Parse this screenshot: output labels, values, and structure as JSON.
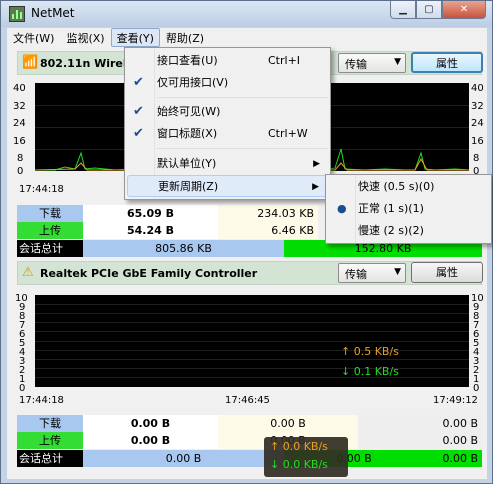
{
  "window": {
    "title": "NetMet"
  },
  "menubar": {
    "items": [
      "文件(W)",
      "监视(X)",
      "查看(Y)",
      "帮助(Z)"
    ]
  },
  "adapters": [
    {
      "name": "802.11n Wireless",
      "icon": "wifi-icon",
      "mode": "传输",
      "properties_label": "属性",
      "y_ticks": [
        "40",
        "32",
        "24",
        "16",
        "8",
        "0"
      ],
      "x_ticks": [
        "17:44:18"
      ],
      "rows": [
        {
          "label": "下载",
          "label_color": "#a8c8f0",
          "v1": "65.09 B",
          "v2": "234.03 KB",
          "v3": ""
        },
        {
          "label": "上传",
          "label_color": "#33dd33",
          "v1": "54.24 B",
          "v2": "6.46 KB",
          "v3": ""
        },
        {
          "label": "会话总计",
          "label_color": "#000000",
          "v1": "805.86 KB",
          "v2": "152.80 KB",
          "v3": ""
        }
      ]
    },
    {
      "name": "Realtek PCIe GbE Family Controller",
      "icon": "warning-icon",
      "mode": "传输",
      "properties_label": "属性",
      "y_ticks": [
        "10",
        "9",
        "8",
        "7",
        "6",
        "5",
        "4",
        "3",
        "2",
        "1",
        "0"
      ],
      "x_ticks": [
        "17:44:18",
        "17:46:45",
        "17:49:12"
      ],
      "overlay": {
        "up": "↑ 0.5 KB/s",
        "down": "↓ 0.1 KB/s"
      },
      "rows": [
        {
          "label": "下载",
          "label_color": "#a8c8f0",
          "v1": "0.00 B",
          "v2": "0.00 B",
          "v3": "0.00 B"
        },
        {
          "label": "上传",
          "label_color": "#33dd33",
          "v1": "0.00 B",
          "v2": "0.00 B",
          "v3": "0.00 B"
        },
        {
          "label": "会话总计",
          "label_color": "#000000",
          "v1": "0.00 B",
          "v2": "0.00 B",
          "v3": "0.00 B"
        }
      ]
    }
  ],
  "view_menu": {
    "items": [
      {
        "label": "接口查看(U)",
        "shortcut": "Ctrl+I",
        "checked": false,
        "submenu": false
      },
      {
        "label": "仅可用接口(V)",
        "shortcut": "",
        "checked": true,
        "submenu": false
      },
      {
        "label": "始终可见(W)",
        "shortcut": "",
        "checked": true,
        "submenu": false
      },
      {
        "label": "窗口标题(X)",
        "shortcut": "Ctrl+W",
        "checked": true,
        "submenu": false
      },
      {
        "label": "默认单位(Y)",
        "shortcut": "",
        "checked": false,
        "submenu": true
      },
      {
        "label": "更新周期(Z)",
        "shortcut": "",
        "checked": false,
        "submenu": true
      }
    ]
  },
  "update_submenu": {
    "items": [
      {
        "label": "快速 (0.5 s)(0)",
        "selected": false
      },
      {
        "label": "正常 (1 s)(1)",
        "selected": true
      },
      {
        "label": "慢速 (2 s)(2)",
        "selected": false
      }
    ]
  },
  "tray_tooltip": {
    "up": "↑ 0.0 KB/s",
    "down": "↓ 0.0 KB/s"
  }
}
